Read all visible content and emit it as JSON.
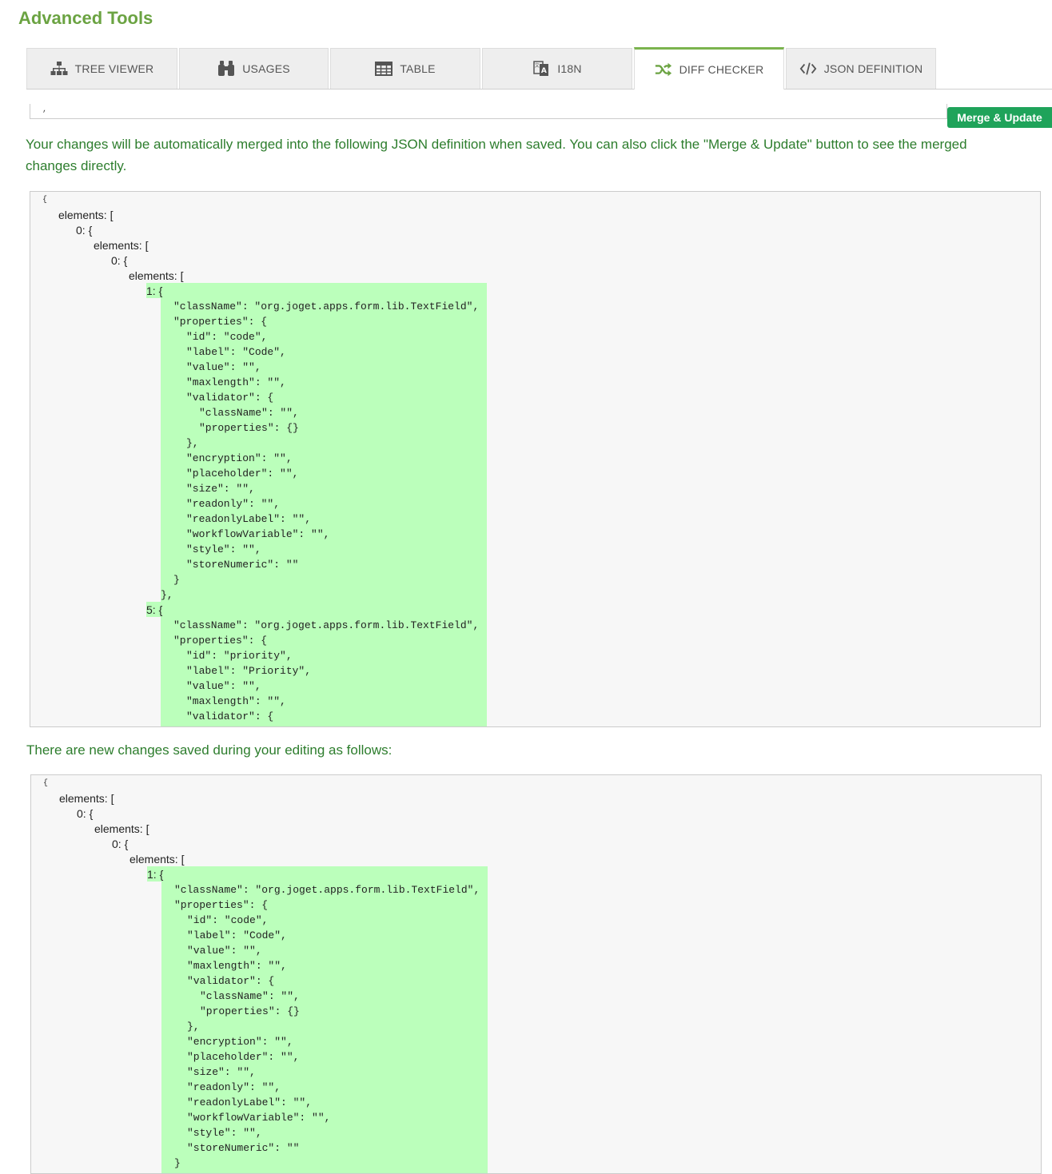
{
  "header": {
    "title": "Advanced Tools"
  },
  "tabs": [
    {
      "label": "TREE VIEWER",
      "icon": "sitemap-icon",
      "active": false
    },
    {
      "label": "USAGES",
      "icon": "binoculars-icon",
      "active": false
    },
    {
      "label": "TABLE",
      "icon": "table-icon",
      "active": false
    },
    {
      "label": "I18N",
      "icon": "language-icon",
      "active": false
    },
    {
      "label": "DIFF CHECKER",
      "icon": "random-icon",
      "active": true
    },
    {
      "label": "JSON DEFINITION",
      "icon": "code-icon",
      "active": false
    }
  ],
  "prev_box_text": ",",
  "merge_button": {
    "label": "Merge & Update",
    "color": "#1fa35a"
  },
  "merged": {
    "description": "Your changes will be automatically merged into the following JSON definition when saved. You can also click the \"Merge & Update\" button to see the merged changes directly.",
    "lines": [
      "{",
      "elements: [",
      "0: {",
      "elements: [",
      "0: {",
      "elements: [",
      "1: {",
      "\"className\": \"org.joget.apps.form.lib.TextField\",",
      "\"properties\": {",
      "\"id\": \"code\",",
      "\"label\": \"Code\",",
      "\"value\": \"\",",
      "\"maxlength\": \"\",",
      "\"validator\": {",
      "\"className\": \"\",",
      "\"properties\": {}",
      "},",
      "\"encryption\": \"\",",
      "\"placeholder\": \"\",",
      "\"size\": \"\",",
      "\"readonly\": \"\",",
      "\"readonlyLabel\": \"\",",
      "\"workflowVariable\": \"\",",
      "\"style\": \"\",",
      "\"storeNumeric\": \"\"",
      "}",
      "},",
      "5: {",
      "\"className\": \"org.joget.apps.form.lib.TextField\",",
      "\"properties\": {",
      "\"id\": \"priority\",",
      "\"label\": \"Priority\",",
      "\"value\": \"\",",
      "\"maxlength\": \"\",",
      "\"validator\": {"
    ]
  },
  "saved": {
    "description": "There are new changes saved during your editing as follows:",
    "lines": [
      "{",
      "elements: [",
      "0: {",
      "elements: [",
      "0: {",
      "elements: [",
      "1: {",
      "\"className\": \"org.joget.apps.form.lib.TextField\",",
      "\"properties\": {",
      "\"id\": \"code\",",
      "\"label\": \"Code\",",
      "\"value\": \"\",",
      "\"maxlength\": \"\",",
      "\"validator\": {",
      "\"className\": \"\",",
      "\"properties\": {}",
      "},",
      "\"encryption\": \"\",",
      "\"placeholder\": \"\",",
      "\"size\": \"\",",
      "\"readonly\": \"\",",
      "\"readonlyLabel\": \"\",",
      "\"workflowVariable\": \"\",",
      "\"style\": \"\",",
      "\"storeNumeric\": \"\"",
      "}"
    ]
  },
  "colors": {
    "title": "#6ba342",
    "info_text": "#2d7d2d",
    "highlight": "#bbffbb",
    "active_tab_border": "#7bb44e"
  }
}
